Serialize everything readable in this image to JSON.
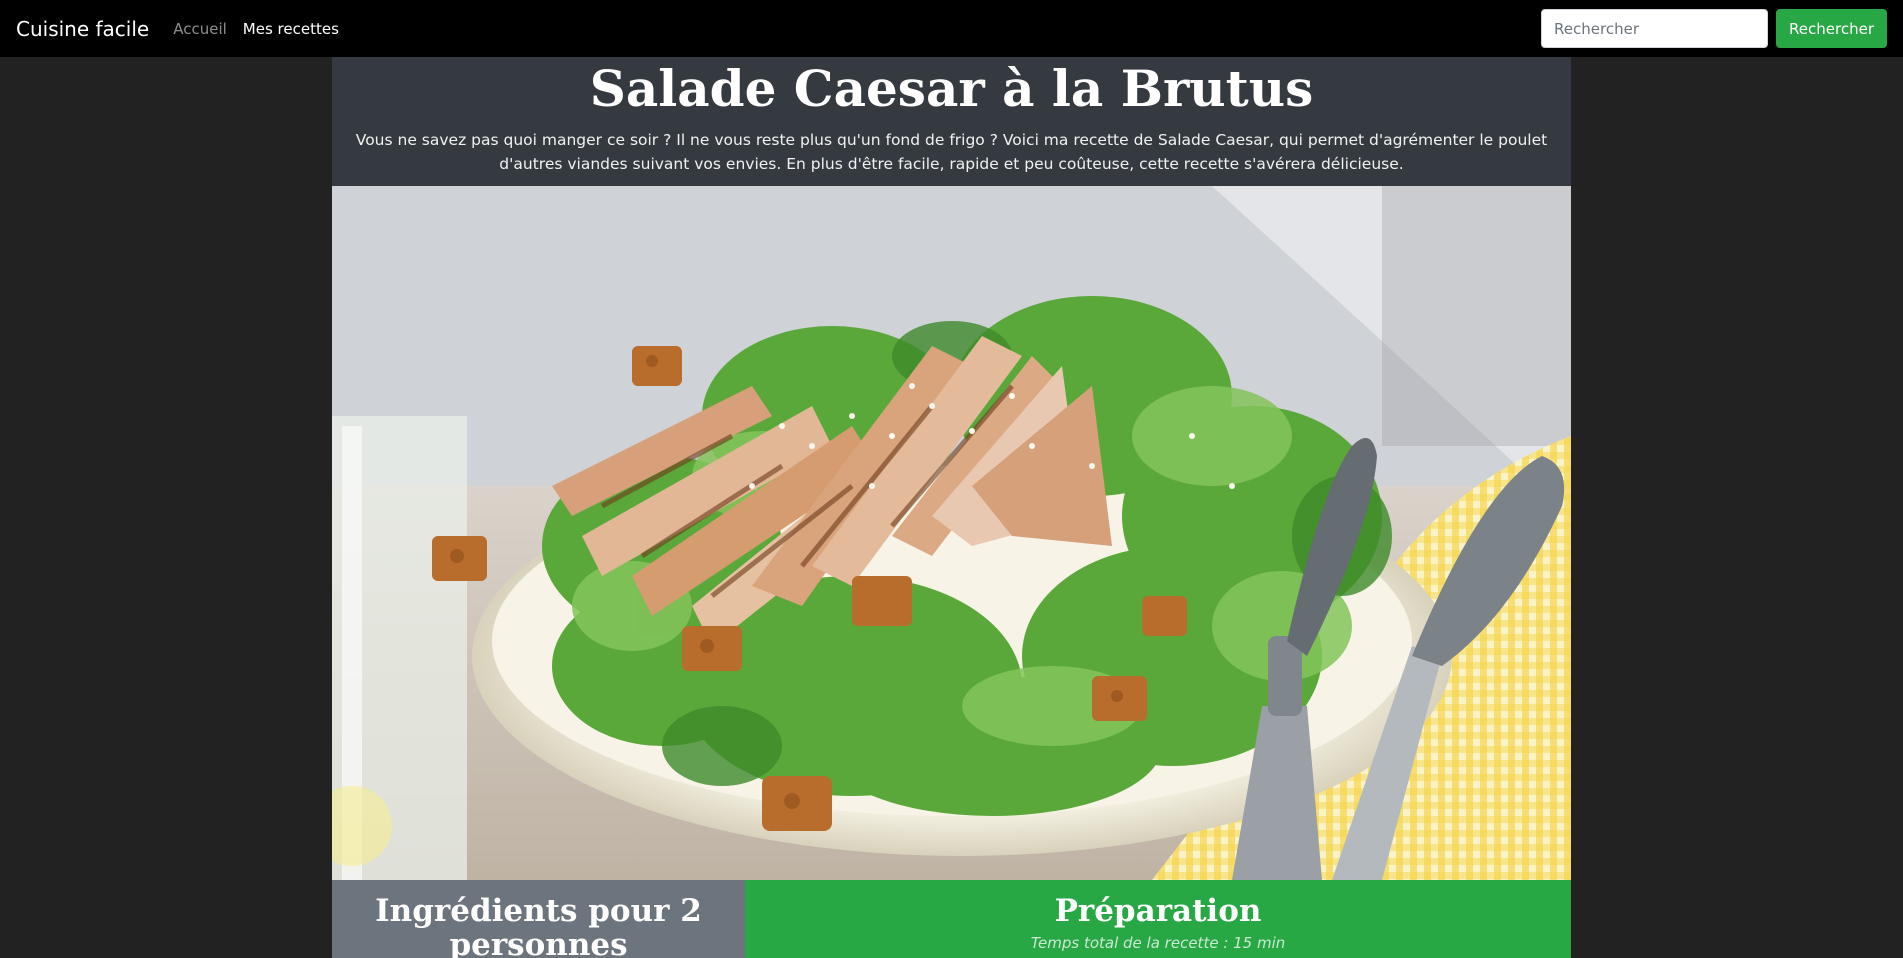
{
  "navbar": {
    "brand": "Cuisine facile",
    "links": [
      {
        "label": "Accueil",
        "state": "muted"
      },
      {
        "label": "Mes recettes",
        "state": "active"
      }
    ],
    "search": {
      "placeholder": "Rechercher",
      "value": "",
      "button_label": "Rechercher"
    }
  },
  "recipe": {
    "title": "Salade Caesar à la Brutus",
    "intro": "Vous ne savez pas quoi manger ce soir ? Il ne vous reste plus qu'un fond de frigo ? Voici ma recette de Salade Caesar, qui permet d'agrémenter le poulet d'autres viandes suivant vos envies. En plus d'être facile, rapide et peu coûteuse, cette recette s'avérera délicieuse.",
    "ingredients_title": "Ingrédients pour 2 personnes",
    "preparation_title": "Préparation",
    "total_time": "Temps total de la recette : 15 min"
  },
  "colors": {
    "navbar_bg": "#000000",
    "page_bg": "#222222",
    "card_bg": "#343a40",
    "accent_green": "#28a745",
    "secondary_gray": "#6c757d"
  }
}
